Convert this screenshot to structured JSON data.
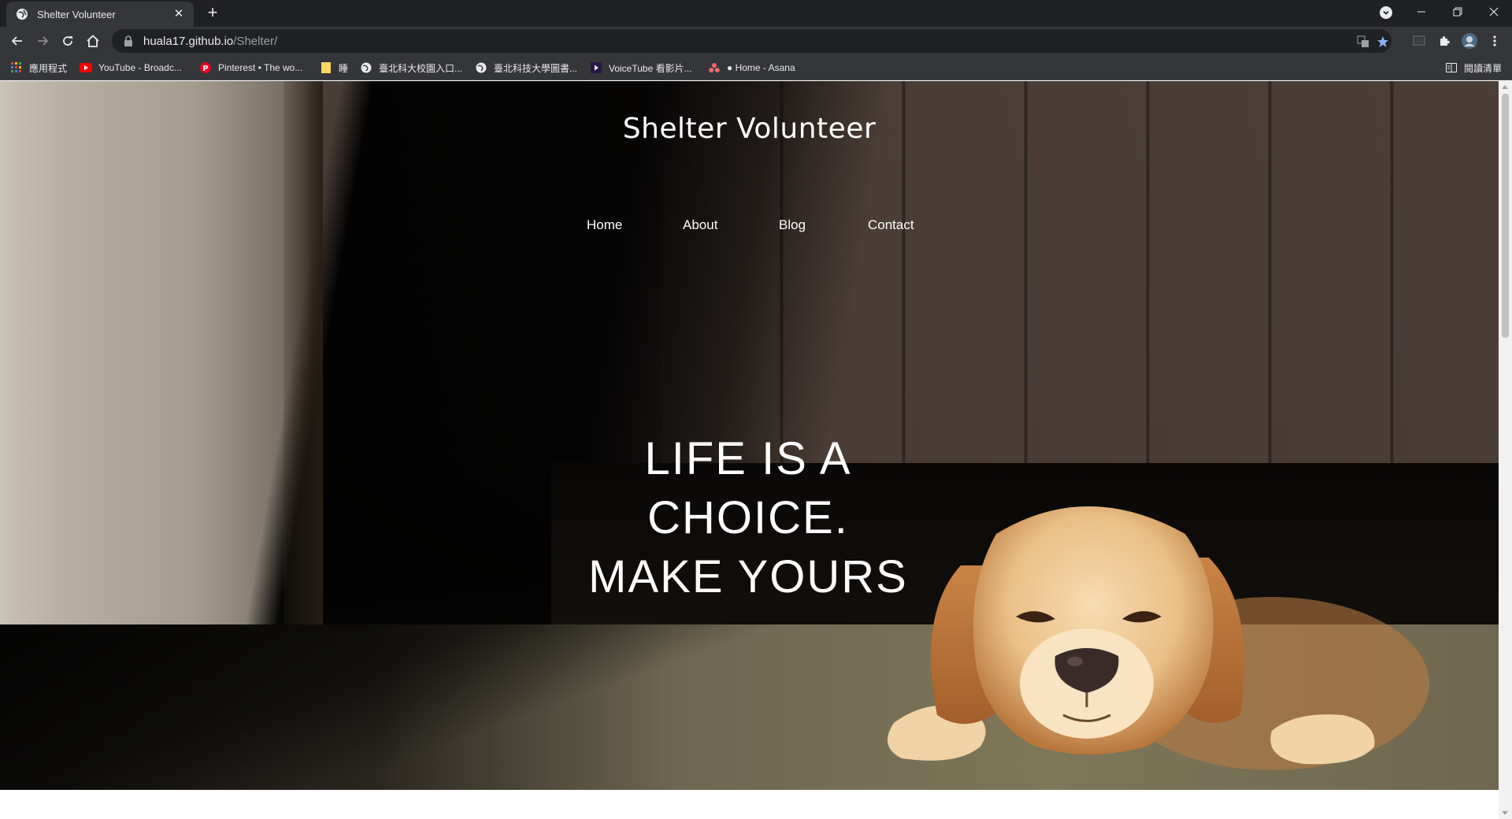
{
  "browser": {
    "tab": {
      "title": "Shelter Volunteer",
      "favicon": "globe-icon"
    },
    "url": {
      "host": "huala17.github.io",
      "path": "/Shelter/"
    },
    "bookmarks": [
      {
        "label": "應用程式",
        "icon": "apps-grid-icon"
      },
      {
        "label": "YouTube - Broadc...",
        "icon": "youtube-icon"
      },
      {
        "label": "Pinterest • The wo...",
        "icon": "pinterest-icon"
      },
      {
        "label": "睡",
        "icon": "folder-icon"
      },
      {
        "label": "臺北科大校園入口...",
        "icon": "globe-icon"
      },
      {
        "label": "臺北科技大學圖書...",
        "icon": "globe-icon"
      },
      {
        "label": "VoiceTube 看影片...",
        "icon": "voicetube-icon"
      },
      {
        "label": "● Home - Asana",
        "icon": "asana-icon"
      }
    ],
    "reading_list": "閱讀清單",
    "colors": {
      "chrome_dark": "#202124",
      "chrome": "#35363a",
      "text": "#e8eaed",
      "star": "#8ab4f8"
    }
  },
  "site": {
    "title": "Shelter Volunteer",
    "nav": [
      "Home",
      "About",
      "Blog",
      "Contact"
    ],
    "slogan": [
      "LIFE IS A",
      "CHOICE.",
      "MAKE YOURS"
    ]
  }
}
